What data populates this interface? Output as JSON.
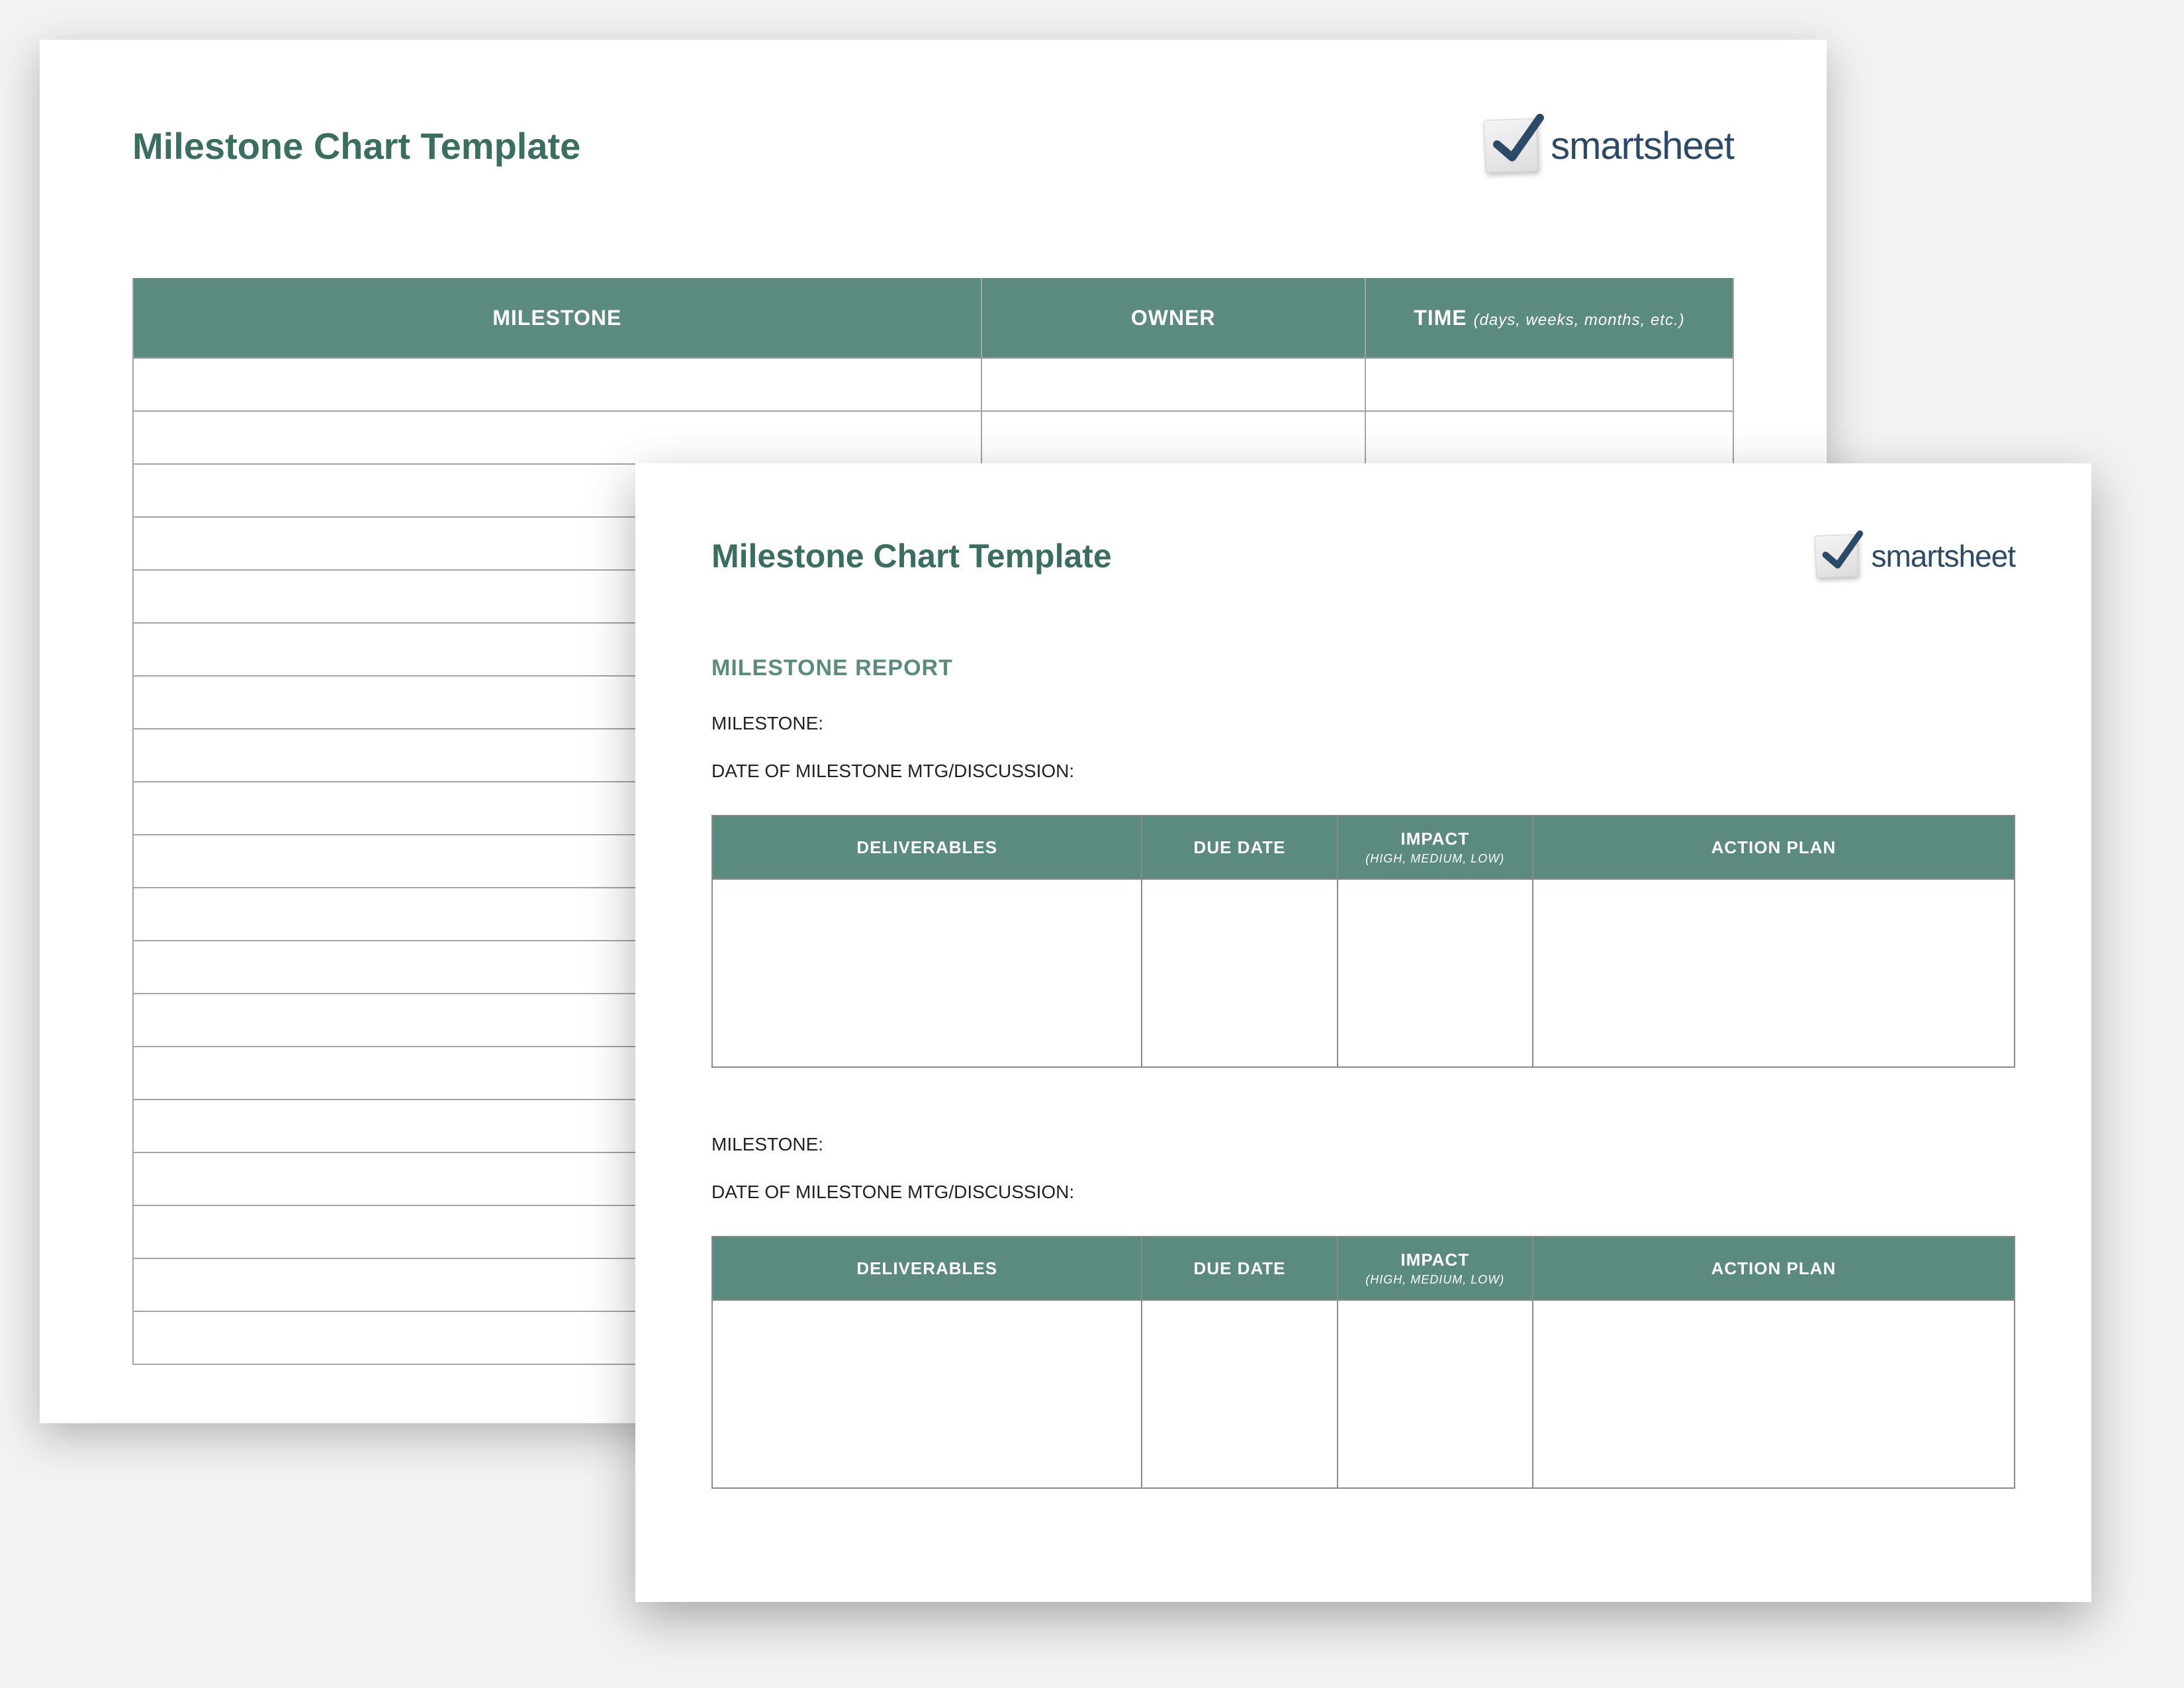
{
  "brand": {
    "name": "smartsheet"
  },
  "back_page": {
    "title": "Milestone Chart Template",
    "columns": {
      "milestone": "MILESTONE",
      "owner": "OWNER",
      "time": "TIME",
      "time_sub": "(days, weeks, months, etc.)"
    },
    "row_count": 19
  },
  "front_page": {
    "title": "Milestone Chart Template",
    "section_title": "MILESTONE REPORT",
    "labels": {
      "milestone": "MILESTONE:",
      "mtg_date": "DATE OF MILESTONE MTG/DISCUSSION:"
    },
    "columns": {
      "deliverables": "DELIVERABLES",
      "due_date": "DUE DATE",
      "impact": "IMPACT",
      "impact_sub": "(HIGH, MEDIUM, LOW)",
      "action_plan": "ACTION PLAN"
    }
  }
}
